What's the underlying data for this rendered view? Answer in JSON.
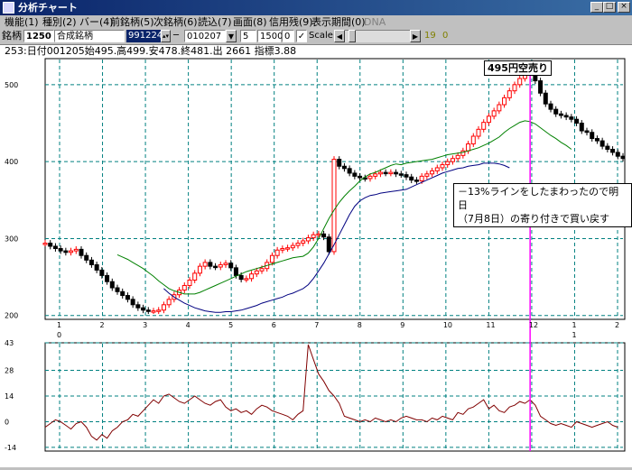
{
  "window": {
    "title": "分析チャート"
  },
  "menu": [
    "機能(1)",
    "種別(2)",
    "バー(4)",
    "前銘柄(5)",
    "次銘柄(6)",
    "読込(7)",
    "画面(8)",
    "信用残(9)",
    "表示期間(0)",
    "DNA"
  ],
  "toolbar": {
    "symbol_label": "銘柄",
    "symbol_code": "1250",
    "symbol_name": "合成銘柄",
    "code_field": "991224",
    "date_field": "010207",
    "val1": "5",
    "val2": "1500",
    "val3": "0",
    "scale_label": "Scale",
    "num_right1": "19",
    "num_right2": "0"
  },
  "info": "253:日付001205始495.高499.安478.終481.出 2661 指標3.88",
  "annotations": {
    "top": "495円空売り",
    "note1": "－13%ラインをしたまわったので明日",
    "note2": "（7月8日）の寄り付きで買い戻す"
  },
  "colors": {
    "grid": "#008080",
    "price_up": "#ff0000",
    "price_down": "#000000",
    "ma_short": "#008000",
    "ma_long": "#000080",
    "osc": "#800000",
    "marker": "#ff00ff"
  },
  "chart_data": [
    {
      "type": "line",
      "title": "",
      "price_ticks": [
        "500",
        "400",
        "300",
        "200"
      ],
      "month_ticks": [
        "1",
        "2",
        "3",
        "4",
        "5",
        "6",
        "7",
        "8",
        "9",
        "10",
        "11",
        "12",
        "1",
        "2"
      ],
      "year_labels": [
        "0",
        "1"
      ],
      "ylim": [
        195,
        535
      ],
      "series": [
        {
          "values": [
            294,
            290,
            287,
            284,
            282,
            284,
            286,
            278,
            272,
            266,
            259,
            252,
            244,
            236,
            231,
            226,
            221,
            214,
            210,
            207,
            206,
            206,
            207,
            214,
            221,
            227,
            233,
            239,
            246,
            255,
            264,
            269,
            264,
            263,
            266,
            268,
            262,
            252,
            247,
            248,
            254,
            258,
            261,
            269,
            278,
            285,
            287,
            288,
            291,
            294,
            297,
            301,
            305,
            306,
            302,
            283,
            403,
            394,
            391,
            385,
            381,
            379,
            378,
            381,
            384,
            386,
            385,
            386,
            384,
            383,
            380,
            376,
            375,
            381,
            384,
            388,
            392,
            396,
            400,
            404,
            408,
            414,
            423,
            433,
            442,
            451,
            459,
            466,
            474,
            483,
            492,
            500,
            508,
            518,
            523,
            505,
            489,
            475,
            468,
            462,
            460,
            458,
            455,
            450,
            440,
            438,
            430,
            427,
            420,
            416,
            412,
            407,
            404
          ]
        },
        {
          "values": [
            null,
            null,
            null,
            null,
            null,
            null,
            null,
            null,
            null,
            null,
            null,
            null,
            null,
            null,
            279,
            276,
            273,
            269,
            265,
            261,
            256,
            251,
            245,
            240,
            235,
            232,
            230,
            228,
            228,
            228,
            230,
            233,
            236,
            239,
            242,
            245,
            248,
            251,
            254,
            257,
            259,
            261,
            263,
            265,
            267,
            269,
            271,
            273,
            275,
            276,
            277,
            281,
            289,
            300,
            313,
            326,
            337,
            347,
            355,
            362,
            368,
            375,
            380,
            384,
            386,
            389,
            392,
            395,
            397,
            396,
            398,
            399,
            400,
            401,
            402,
            403,
            405,
            407,
            409,
            410,
            411,
            412,
            414,
            416,
            418,
            421,
            424,
            428,
            432,
            438,
            443,
            447,
            451,
            453,
            452,
            449,
            444,
            439,
            434,
            430,
            425,
            421,
            416
          ]
        },
        {
          "values": [
            null,
            null,
            null,
            null,
            null,
            null,
            null,
            null,
            null,
            null,
            null,
            null,
            null,
            null,
            null,
            null,
            null,
            null,
            null,
            null,
            null,
            null,
            null,
            235,
            229,
            224,
            220,
            216,
            213,
            210,
            208,
            206,
            205,
            204,
            204,
            205,
            205,
            206,
            207,
            209,
            211,
            213,
            216,
            218,
            220,
            222,
            224,
            227,
            229,
            232,
            235,
            240,
            248,
            258,
            268,
            280,
            292,
            305,
            318,
            331,
            342,
            349,
            353,
            356,
            357,
            359,
            360,
            361,
            362,
            363,
            364,
            367,
            370,
            373,
            376,
            379,
            382,
            385,
            387,
            389,
            391,
            392,
            394,
            395,
            396,
            398,
            398,
            398,
            397,
            395,
            392
          ]
        }
      ]
    },
    {
      "type": "line",
      "title": "",
      "ticks": [
        "43",
        "28",
        "14",
        "0",
        "-14"
      ],
      "ylim": [
        -16,
        43
      ],
      "series": [
        {
          "values": [
            -3,
            -1,
            1,
            0,
            -2,
            -4,
            -1,
            0,
            -3,
            -8,
            -10,
            -7,
            -9,
            -5,
            -3,
            0,
            1,
            4,
            3,
            6,
            9,
            12,
            10,
            14,
            15,
            13,
            11,
            10,
            12,
            14,
            12,
            10,
            9,
            11,
            12,
            8,
            6,
            7,
            5,
            6,
            4,
            7,
            9,
            8,
            6,
            5,
            4,
            3,
            1,
            4,
            6,
            42,
            34,
            26,
            22,
            17,
            14,
            10,
            3,
            2,
            1,
            0,
            1,
            0,
            2,
            1,
            0,
            1,
            0,
            2,
            3,
            2,
            1,
            1,
            0,
            2,
            1,
            3,
            2,
            1,
            5,
            4,
            7,
            8,
            10,
            12,
            7,
            9,
            6,
            5,
            8,
            9,
            11,
            10,
            12,
            9,
            3,
            1,
            -1,
            -2,
            -1,
            -2,
            -3,
            0,
            -1,
            -2,
            -3,
            -2,
            -1,
            0,
            -2,
            -3
          ]
        }
      ]
    }
  ]
}
